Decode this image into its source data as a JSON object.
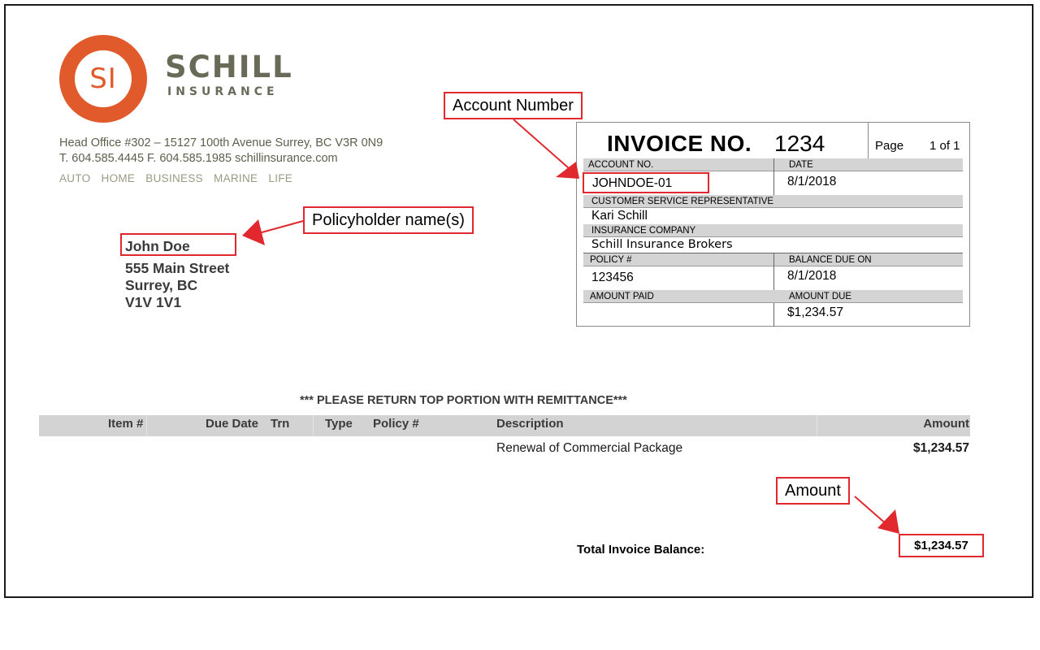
{
  "company": {
    "logo_initials": "SI",
    "name": "SCHILL",
    "subtitle": "INSURANCE",
    "address_line": "Head Office #302 – 15127 100th Avenue Surrey, BC V3R 0N9",
    "contact_line": "T. 604.585.4445 F. 604.585.1985 schillinsurance.com",
    "lines_of_business": [
      "AUTO",
      "HOME",
      "BUSINESS",
      "MARINE",
      "LIFE"
    ],
    "brand_color": "#e05a2b",
    "text_color": "#6a6a58"
  },
  "policyholder": {
    "name": "John Doe",
    "street": "555 Main Street",
    "city": "Surrey, BC",
    "postal": "V1V 1V1"
  },
  "invoice": {
    "title": "INVOICE NO.",
    "number": "1234",
    "page_label": "Page",
    "page_value": "1 of 1",
    "fields": {
      "account_no_label": "ACCOUNT NO.",
      "account_no": "JOHNDOE-01",
      "date_label": "DATE",
      "date": "8/1/2018",
      "csr_label": "CUSTOMER SERVICE REPRESENTATIVE",
      "csr": "Kari Schill",
      "company_label": "INSURANCE COMPANY",
      "company": "Schill Insurance Brokers",
      "policy_label": "POLICY #",
      "policy": "123456",
      "balance_due_on_label": "BALANCE DUE ON",
      "balance_due_on": "8/1/2018",
      "amount_paid_label": "AMOUNT PAID",
      "amount_paid": "",
      "amount_due_label": "AMOUNT DUE",
      "amount_due": "$1,234.57"
    }
  },
  "remittance_note": "*** PLEASE RETURN TOP PORTION WITH REMITTANCE***",
  "table": {
    "headers": [
      "Item #",
      "Due Date",
      "Trn",
      "Type",
      "Policy #",
      "Description",
      "Amount"
    ],
    "rows": [
      {
        "item": "",
        "due_date": "",
        "trn": "",
        "type": "",
        "policy": "",
        "description": "Renewal of Commercial Package",
        "amount": "$1,234.57"
      }
    ]
  },
  "total": {
    "label": "Total Invoice Balance:",
    "value": "$1,234.57"
  },
  "annotations": {
    "account_number": "Account Number",
    "policyholder": "Policyholder name(s)",
    "amount": "Amount",
    "color": "#e0282e"
  }
}
